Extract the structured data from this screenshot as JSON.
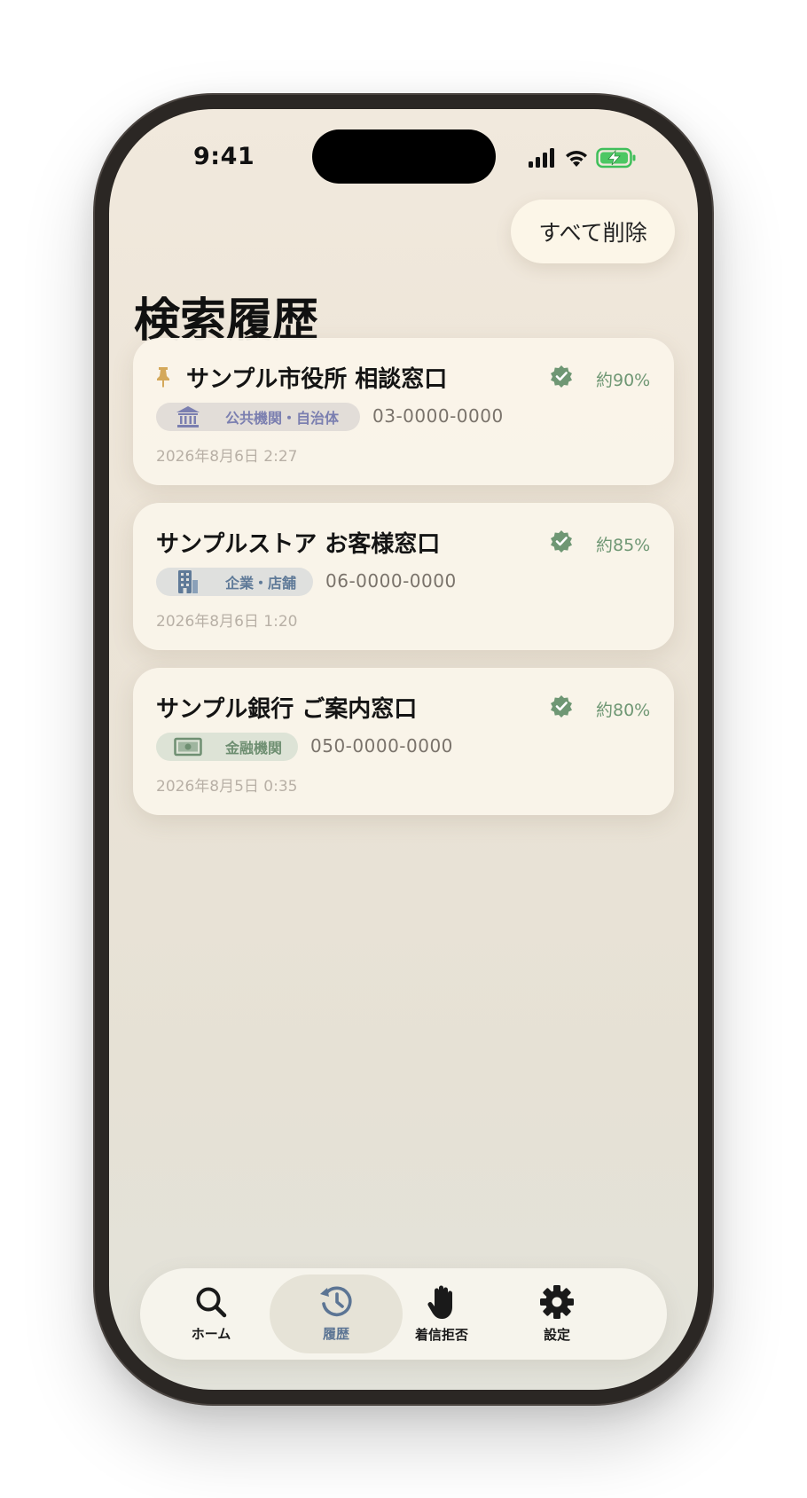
{
  "status_bar": {
    "time": "9:41"
  },
  "header": {
    "delete_all_label": "すべて削除",
    "title": "検索履歴"
  },
  "history": [
    {
      "pinned": true,
      "name": "サンプル市役所 相談窓口",
      "score": "約90%",
      "category": {
        "label": "公共機関・自治体",
        "icon": "government-building-icon",
        "color": "#7b7fb0",
        "bg": "#e2ddd8"
      },
      "phone": "03-0000-0000",
      "date": "2026年8月6日 2:27"
    },
    {
      "pinned": false,
      "name": "サンプルストア お客様窓口",
      "score": "約85%",
      "category": {
        "label": "企業・店舗",
        "icon": "office-building-icon",
        "color": "#5f7a98",
        "bg": "#dfe0de"
      },
      "phone": "06-0000-0000",
      "date": "2026年8月6日 1:20"
    },
    {
      "pinned": false,
      "name": "サンプル銀行 ご案内窓口",
      "score": "約80%",
      "category": {
        "label": "金融機関",
        "icon": "banknote-icon",
        "color": "#6f8f72",
        "bg": "#dde3d6"
      },
      "phone": "050-0000-0000",
      "date": "2026年8月5日 0:35"
    }
  ],
  "tabbar": {
    "items": [
      {
        "label": "ホーム",
        "icon": "search-icon",
        "active": false
      },
      {
        "label": "履歴",
        "icon": "history-icon",
        "active": true
      },
      {
        "label": "着信拒否",
        "icon": "hand-stop-icon",
        "active": false
      },
      {
        "label": "設定",
        "icon": "gear-icon",
        "active": false
      }
    ]
  },
  "colors": {
    "accent_green": "#6f9774",
    "history_active": "#5c7594",
    "pin": "#d4a85a"
  }
}
